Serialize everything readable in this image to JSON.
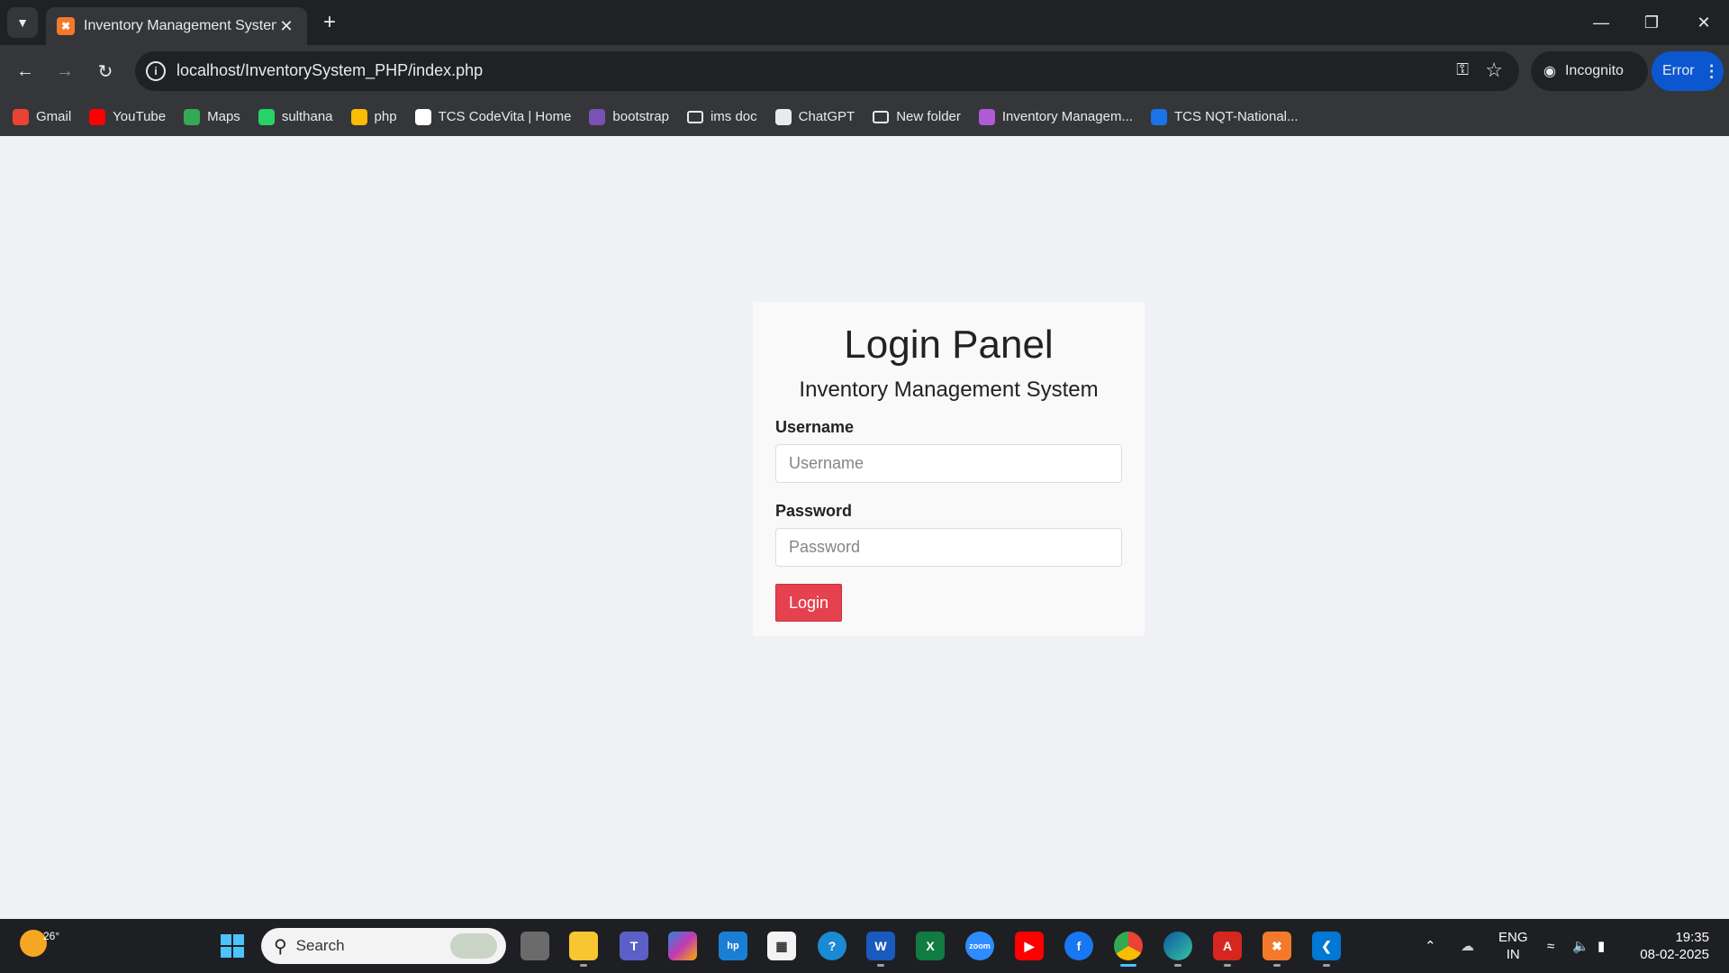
{
  "browser": {
    "tab_title": "Inventory Management System",
    "url": "localhost/InventorySystem_PHP/index.php",
    "incognito_label": "Incognito",
    "error_label": "Error",
    "bookmarks": [
      {
        "label": "Gmail",
        "icon": "gmail-icon",
        "color": "#ea4335"
      },
      {
        "label": "YouTube",
        "icon": "youtube-icon",
        "color": "#ff0000"
      },
      {
        "label": "Maps",
        "icon": "maps-icon",
        "color": "#34a853"
      },
      {
        "label": "sulthana",
        "icon": "whatsapp-icon",
        "color": "#25d366"
      },
      {
        "label": "php",
        "icon": "drive-icon",
        "color": "#fbbc04"
      },
      {
        "label": "TCS CodeVita | Home",
        "icon": "tcs-icon",
        "color": "#ffffff"
      },
      {
        "label": "bootstrap",
        "icon": "bootstrap-icon",
        "color": "#7952b3"
      },
      {
        "label": "ims doc",
        "icon": "folder-icon",
        "color": "#e8eaed"
      },
      {
        "label": "ChatGPT",
        "icon": "chatgpt-icon",
        "color": "#e8eaed"
      },
      {
        "label": "New folder",
        "icon": "folder-icon",
        "color": "#e8eaed"
      },
      {
        "label": "Inventory Managem...",
        "icon": "link-icon",
        "color": "#b05ad6"
      },
      {
        "label": "TCS NQT-National...",
        "icon": "fv-icon",
        "color": "#1a73e8"
      }
    ]
  },
  "login": {
    "title": "Login Panel",
    "subtitle": "Inventory Management System",
    "username_label": "Username",
    "username_placeholder": "Username",
    "password_label": "Password",
    "password_placeholder": "Password",
    "button_label": "Login",
    "accent_color": "#e5414e"
  },
  "taskbar": {
    "weather_temp": "26°",
    "search_placeholder": "Search",
    "language": "ENG",
    "region": "IN",
    "time": "19:35",
    "date": "08-02-2025"
  }
}
